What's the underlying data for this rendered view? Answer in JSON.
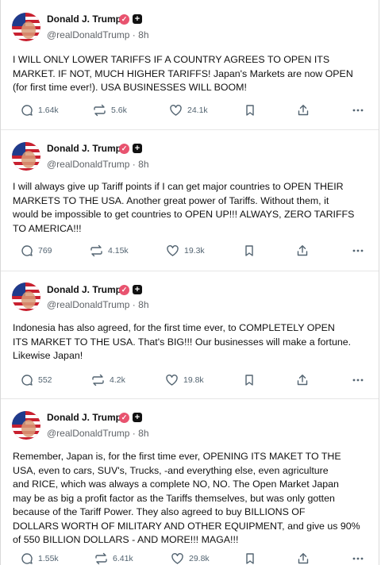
{
  "posts": [
    {
      "name": "Donald J. Trump",
      "handle": "@realDonaldTrump",
      "time": "8h",
      "text": "I WILL ONLY LOWER TARIFFS IF A COUNTRY AGREES TO OPEN ITS\nMARKET. IF NOT, MUCH HIGHER TARIFFS! Japan's Markets are now OPEN\n(for first time ever!). USA BUSINESSES WILL BOOM!",
      "replies": "1.64k",
      "retruths": "5.6k",
      "likes": "24.1k"
    },
    {
      "name": "Donald J. Trump",
      "handle": "@realDonaldTrump",
      "time": "8h",
      "text": "I will always give up Tariff points if I can get major countries to OPEN THEIR\nMARKETS TO THE USA. Another great power of Tariffs. Without them, it\nwould be impossible to get countries to OPEN UP!!! ALWAYS, ZERO TARIFFS\nTO AMERICA!!!",
      "replies": "769",
      "retruths": "4.15k",
      "likes": "19.3k"
    },
    {
      "name": "Donald J. Trump",
      "handle": "@realDonaldTrump",
      "time": "8h",
      "text": "Indonesia has also agreed, for the first time ever, to COMPLETELY OPEN\nITS MARKET TO THE USA. That's BIG!!! Our businesses will make a fortune.\nLikewise Japan!",
      "replies": "552",
      "retruths": "4.2k",
      "likes": "19.8k"
    },
    {
      "name": "Donald J. Trump",
      "handle": "@realDonaldTrump",
      "time": "8h",
      "text": "Remember, Japan is, for the first time ever, OPENING ITS MAKET TO THE\nUSA, even to cars, SUV's, Trucks, -and everything else, even agriculture\nand RICE, which was always a complete NO, NO. The Open Market Japan\nmay be as big a profit factor as the Tariffs themselves, but was only gotten\nbecause of the Tariff Power. They also agreed to buy BILLIONS OF\nDOLLARS WORTH OF MILITARY AND OTHER EQUIPMENT, and give us 90%\nof 550 BILLION DOLLARS - AND MORE!!! MAGA!!!",
      "replies": "1.55k",
      "retruths": "6.41k",
      "likes": "29.8k"
    }
  ],
  "colors": {
    "verified_badge": "#e8536f",
    "action_gray": "#536471",
    "handle_gray": "#5f6368"
  }
}
